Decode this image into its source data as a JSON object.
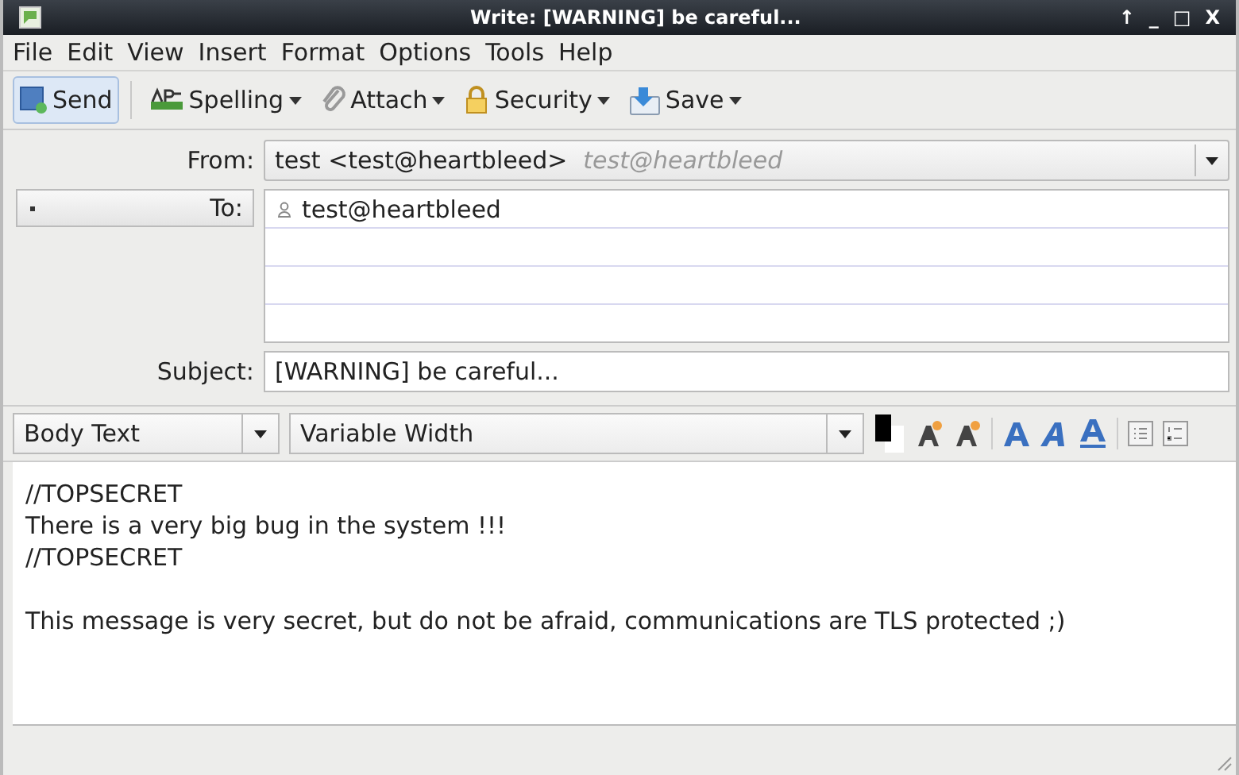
{
  "window": {
    "title": "Write: [WARNING] be careful...",
    "controls": [
      "↑",
      "_",
      "□",
      "X"
    ]
  },
  "menu": [
    "File",
    "Edit",
    "View",
    "Insert",
    "Format",
    "Options",
    "Tools",
    "Help"
  ],
  "toolbar": [
    {
      "label": "Send",
      "kind": "send",
      "dropdown": false,
      "hovered": true
    },
    {
      "label": "Spelling",
      "kind": "spelling",
      "dropdown": true,
      "hovered": false
    },
    {
      "label": "Attach",
      "kind": "attach",
      "dropdown": true,
      "hovered": false
    },
    {
      "label": "Security",
      "kind": "security",
      "dropdown": true,
      "hovered": false
    },
    {
      "label": "Save",
      "kind": "save",
      "dropdown": true,
      "hovered": false
    }
  ],
  "from": {
    "label": "From:",
    "value": "test <test@heartbleed>",
    "hint": "test@heartbleed"
  },
  "to": {
    "type_button": "To:",
    "recipients": [
      "test@heartbleed"
    ]
  },
  "subject": {
    "label": "Subject:",
    "value": "[WARNING] be careful..."
  },
  "format_bar": {
    "paragraph_style": "Body Text",
    "font": "Variable Width"
  },
  "body": {
    "paragraphs": [
      {
        "lines": [
          "//TOPSECRET",
          "There is a very big bug in the system !!!",
          "//TOPSECRET"
        ]
      },
      {
        "lines": [
          "This message is very secret, but do not be afraid, communications are TLS protected ;)"
        ]
      }
    ]
  }
}
